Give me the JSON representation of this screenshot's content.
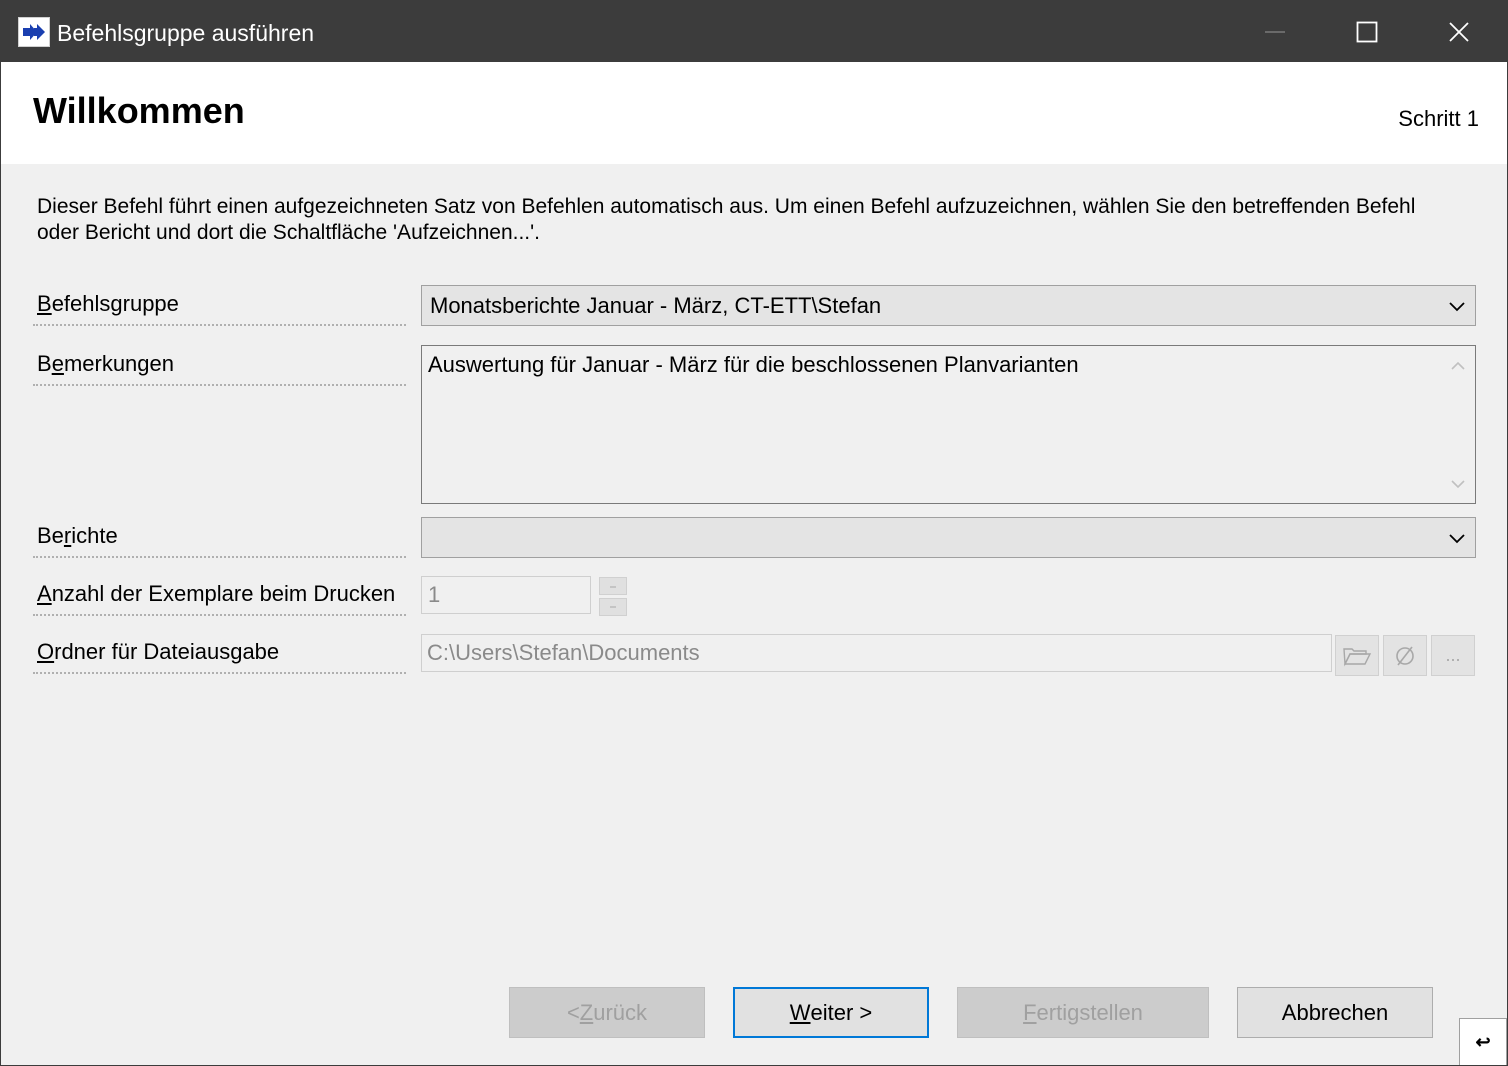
{
  "window": {
    "title": "Befehlsgruppe ausführen",
    "icon": "run-command-group-icon"
  },
  "header": {
    "title": "Willkommen",
    "step": "Schritt 1"
  },
  "intro": "Dieser Befehl führt einen aufgezeichneten Satz von Befehlen automatisch aus. Um einen Befehl aufzuzeichnen, wählen Sie den betreffenden Befehl oder Bericht und dort die Schaltfläche 'Aufzeichnen...'.",
  "fields": {
    "befehlsgruppe": {
      "label_first": "B",
      "label_rest": "efehlsgruppe",
      "value": "Monatsberichte Januar - März, CT-ETT\\Stefan"
    },
    "bemerkungen": {
      "label_pre": "B",
      "label_ul": "e",
      "label_rest": "merkungen",
      "value": "Auswertung für Januar - März für die beschlossenen Planvarianten"
    },
    "berichte": {
      "label_pre": "Be",
      "label_ul": "r",
      "label_rest": "ichte",
      "value": ""
    },
    "exemplare": {
      "label_first": "A",
      "label_rest": "nzahl der Exemplare beim Drucken",
      "value": "1"
    },
    "ordner": {
      "label_first": "O",
      "label_rest": "rdner für Dateiausgabe",
      "value": "C:\\Users\\Stefan\\Documents",
      "more_label": "..."
    }
  },
  "buttons": {
    "back_pre": "< ",
    "back_ul": "Z",
    "back_rest": "urück",
    "next_ul": "W",
    "next_rest": "eiter >",
    "finish_ul": "F",
    "finish_rest": "ertigstellen",
    "cancel": "Abbrechen",
    "help": "↩"
  }
}
